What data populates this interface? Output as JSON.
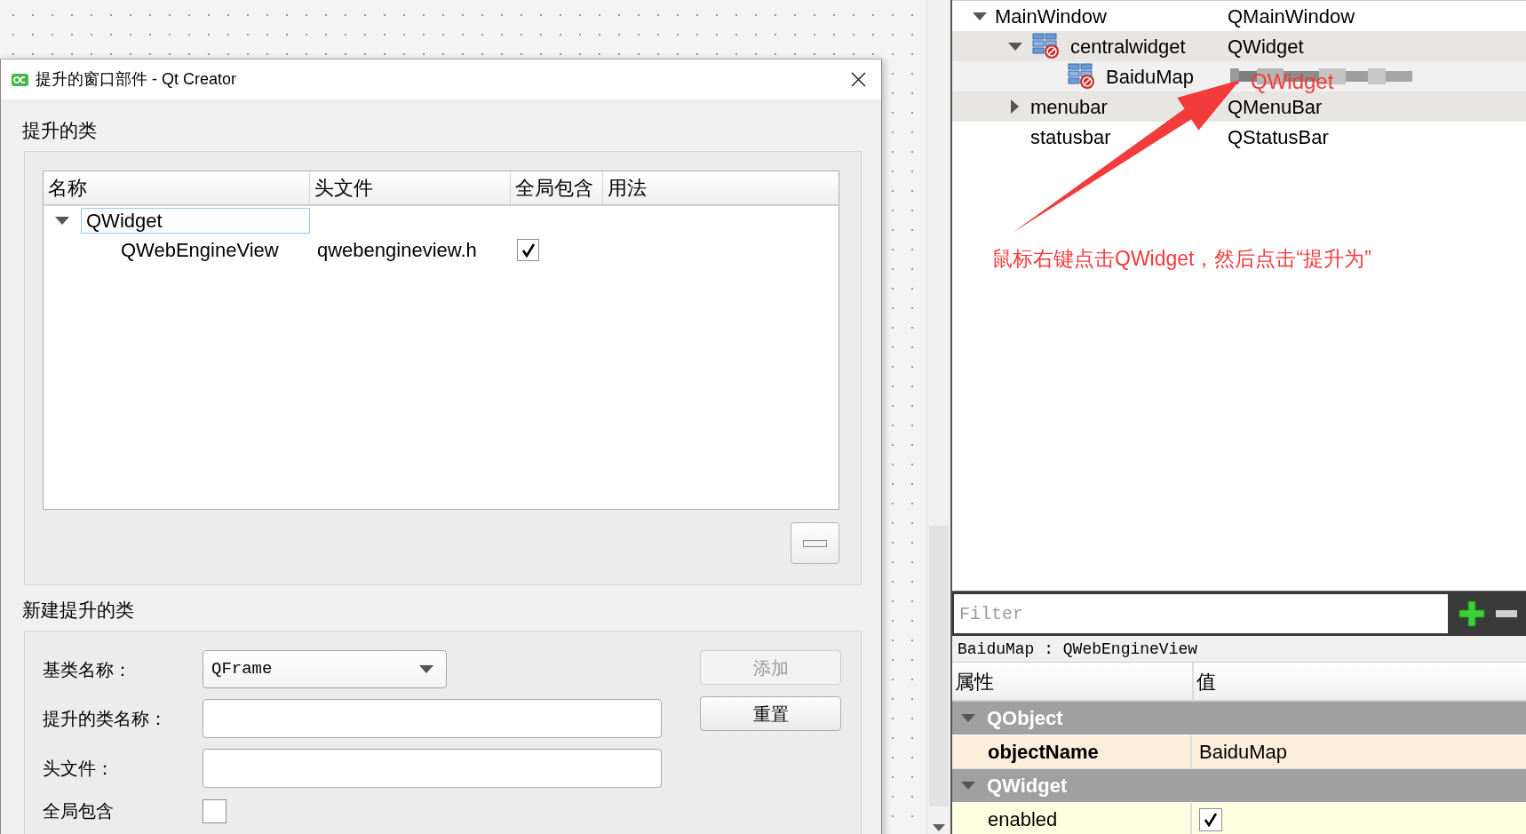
{
  "dialog": {
    "title": "提升的窗口部件 - Qt Creator",
    "promoted_section": {
      "title": "提升的类",
      "columns": [
        "名称",
        "头文件",
        "全局包含",
        "用法"
      ],
      "tree": [
        {
          "name": "QWidget",
          "selected": true,
          "expanded": true,
          "children": [
            {
              "name": "QWebEngineView",
              "header": "qwebengineview.h",
              "global_include": true,
              "selected": false
            }
          ]
        }
      ]
    },
    "new_section": {
      "title": "新建提升的类",
      "base_class": {
        "label": "基类名称：",
        "value": "QFrame"
      },
      "class_name": {
        "label": "提升的类名称："
      },
      "header_file": {
        "label": "头文件："
      },
      "global_include": {
        "label": "全局包含",
        "checked": false
      },
      "buttons": [
        {
          "label": "添加",
          "disabled": true
        },
        {
          "label": "重置",
          "disabled": false
        }
      ]
    }
  },
  "object_tree": [
    {
      "name": "MainWindow",
      "class": "QMainWindow",
      "expanded": true,
      "kind": "plain",
      "children": [
        {
          "name": "centralwidget",
          "class": "QWidget",
          "expanded": true,
          "kind": "widget",
          "children": [
            {
              "name": "BaiduMap",
              "kind": "widget",
              "redacted": true
            }
          ]
        },
        {
          "name": "menubar",
          "class": "QMenuBar",
          "expanded": false,
          "kind": "plain"
        },
        {
          "name": "statusbar",
          "class": "QStatusBar",
          "kind": "plain"
        }
      ]
    }
  ],
  "annotation": {
    "label": "QWidget",
    "text": "鼠标右键点击QWidget，然后点击“提升为”"
  },
  "property_editor": {
    "filter": {
      "placeholder": "Filter"
    },
    "object_label": "BaiduMap : QWebEngineView",
    "columns": [
      "属性",
      "值"
    ],
    "groups": [
      {
        "name": "QObject",
        "expanded": true,
        "properties": [
          {
            "name": "objectName",
            "kind": "text",
            "value": "BaiduMap",
            "changed": true,
            "color": "#fdeedc"
          }
        ]
      },
      {
        "name": "QWidget",
        "expanded": true,
        "properties": [
          {
            "name": "enabled",
            "kind": "check",
            "checked": true,
            "changed": false,
            "color": "#fefee0"
          }
        ]
      }
    ]
  }
}
